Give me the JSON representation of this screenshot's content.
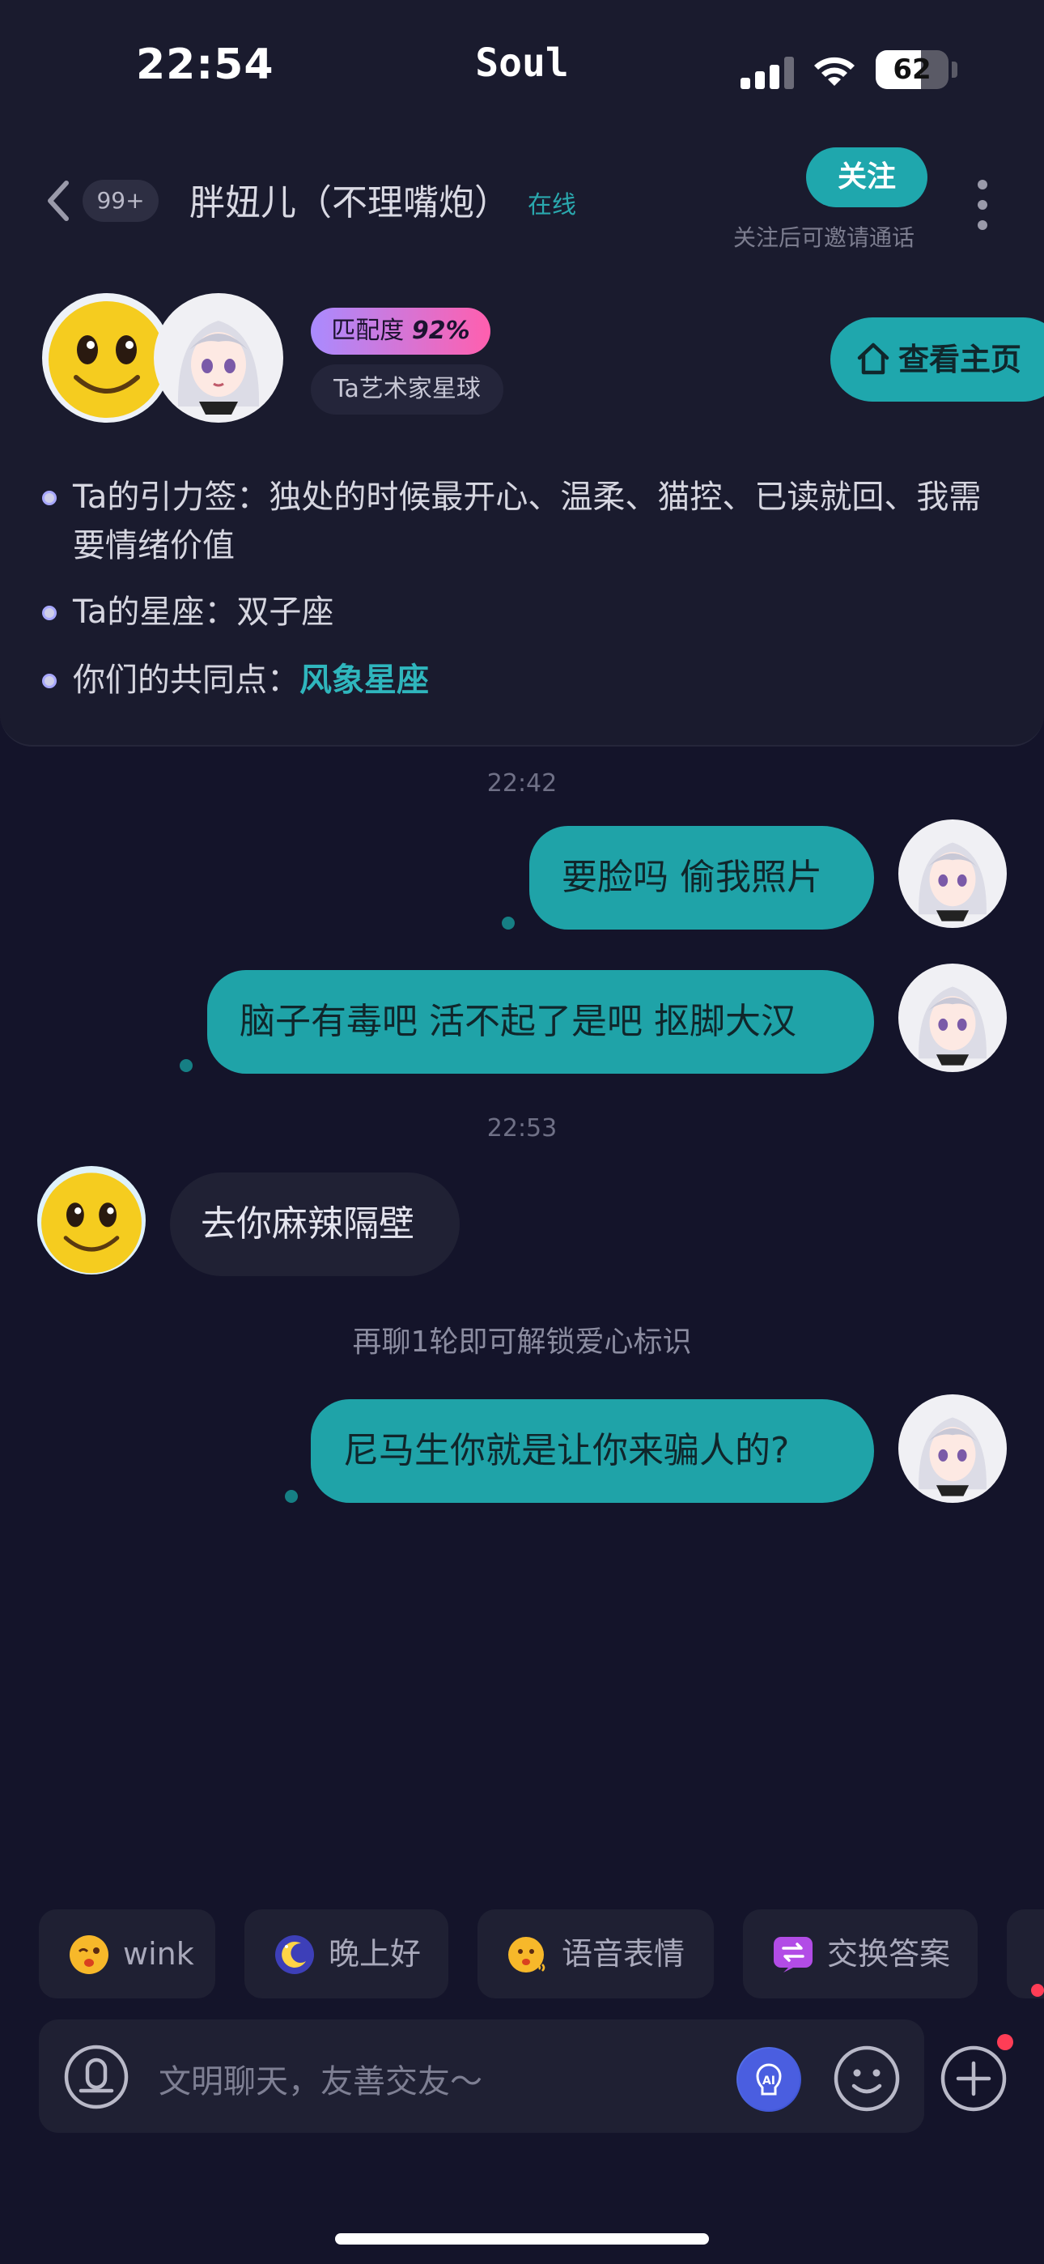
{
  "status_bar": {
    "time": "22:54",
    "app_name": "Soul",
    "battery_level": "62",
    "battery_fraction": 0.62
  },
  "header": {
    "unread_count": "99+",
    "title": "胖妞儿（不理嘴炮）",
    "online_status": "在线",
    "follow_label": "关注",
    "follow_hint": "关注后可邀请通话"
  },
  "profile": {
    "match_label": "匹配度",
    "match_value": "92%",
    "planet_tag": "Ta艺术家星球",
    "home_button": "查看主页",
    "tags_line": "Ta的引力签：独处的时候最开心、温柔、猫控、已读就回、我需要情绪价值",
    "zodiac_line": "Ta的星座：双子座",
    "common_label": "你们的共同点：",
    "common_value": "风象星座"
  },
  "chat": {
    "timestamp_1": "22:42",
    "msg_1": "要脸吗 偷我照片",
    "msg_2": "脑子有毒吧 活不起了是吧 抠脚大汉",
    "timestamp_2": "22:53",
    "msg_3": "去你麻辣隔壁",
    "system_notice": "再聊1轮即可解锁爱心标识",
    "msg_4": "尼马生你就是让你来骗人的?"
  },
  "quick_replies": [
    {
      "label": "wink",
      "icon": "wink-emoji-icon"
    },
    {
      "label": "晚上好",
      "icon": "moon-icon"
    },
    {
      "label": "语音表情",
      "icon": "voice-emoji-icon"
    },
    {
      "label": "交换答案",
      "icon": "exchange-icon"
    }
  ],
  "input": {
    "placeholder": "文明聊天，友善交友～"
  },
  "colors": {
    "accent": "#1fa7ad",
    "background": "#14142a",
    "card": "#1a1b2e"
  }
}
